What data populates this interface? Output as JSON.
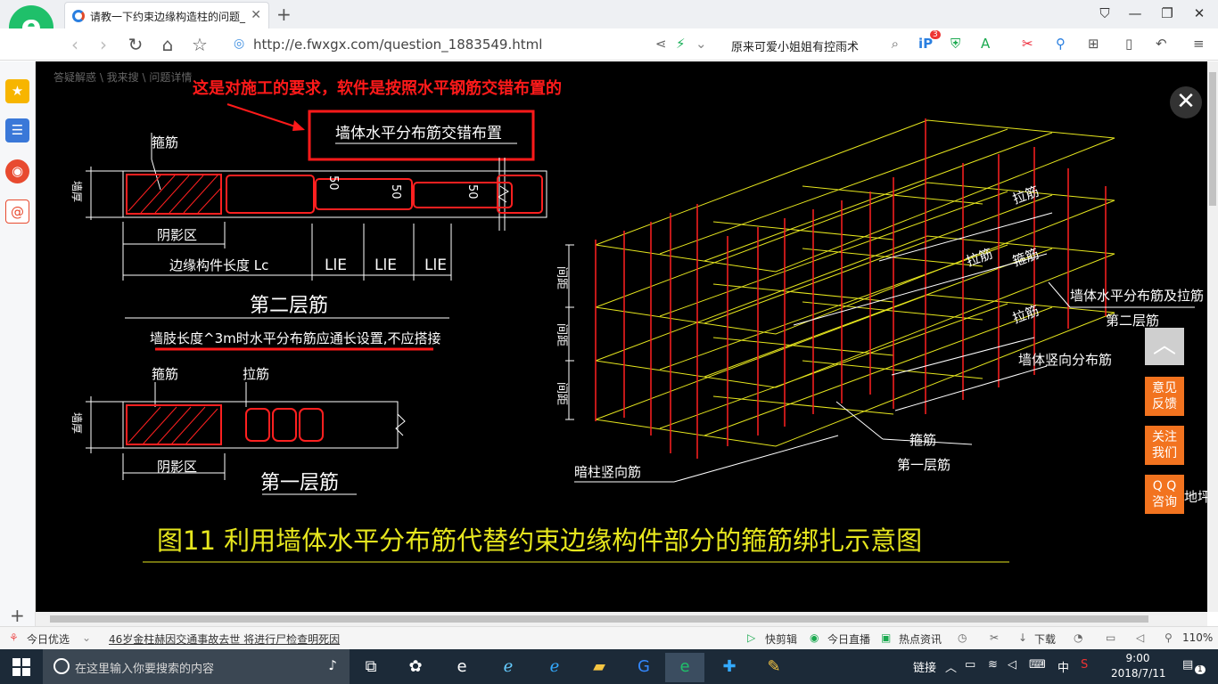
{
  "browser": {
    "tab_title": "请教一下约束边缘构造柱的问题_",
    "tab_close": "✕",
    "new_tab": "+",
    "url": "http://e.fwxgx.com/question_1883549.html",
    "search_query": "原来可爱小姐姐有控雨术",
    "badge_count": "3"
  },
  "breadcrumb": "答疑解惑 \\ 我来搜 \\ 问题详情",
  "drawing": {
    "annotation": "这是对施工的要求，软件是按照水平钢筋交错布置的",
    "boxed_label": "墙体水平分布筋交错布置",
    "top_section": {
      "stirrup_label": "箍筋",
      "left_dim": "墙厚",
      "shade_label": "阴影区",
      "length_label": "边缘构件长度 Lc",
      "lle": [
        "LlE",
        "LlE",
        "LlE"
      ],
      "offset_a": "50",
      "offset_b": "50",
      "offset_c": "50",
      "layer_title": "第二层筋",
      "note": "墙肢长度^3m时水平分布筋应通长设置,不应搭接"
    },
    "bottom_section": {
      "stirrup_label": "箍筋",
      "tie_label": "拉筋",
      "left_dim": "墙厚",
      "shade_label": "阴影区",
      "layer_title": "第一层筋"
    },
    "iso": {
      "spacing_labels": [
        "间距",
        "间距",
        "间距"
      ],
      "tie_1": "拉筋",
      "tie_2": "拉筋",
      "tie_3": "拉筋",
      "stirrup_top": "箍筋",
      "wall_horiz_tie": "墙体水平分布筋及拉筋",
      "layer_two": "第二层筋",
      "wall_vertical": "墙体竖向分布筋",
      "column_vertical": "暗柱竖向筋",
      "stirrup_bottom": "箍筋",
      "layer_one": "第一层筋",
      "cut_text": "地坪"
    },
    "caption": "图11  利用墙体水平分布筋代替约束边缘构件部分的箍筋绑扎示意图"
  },
  "float_buttons": {
    "top": "︿",
    "feedback": [
      "意见",
      "反馈"
    ],
    "follow": [
      "关注",
      "我们"
    ],
    "qq": [
      "Q Q",
      "咨询"
    ],
    "close": "✕"
  },
  "statusbar": {
    "today": "今日优选",
    "headline": "46岁金柱赫因交通事故去世 将进行尸检查明死因",
    "clip": "快剪辑",
    "live": "今日直播",
    "news": "热点资讯",
    "download": "下载",
    "zoom": "110%"
  },
  "taskbar": {
    "search_placeholder": "在这里输入你要搜索的内容",
    "link_label": "链接",
    "ime": "中",
    "time": "9:00",
    "date": "2018/7/11",
    "notif_count": "1"
  },
  "colors": {
    "cad_bg": "#000000",
    "cad_white": "#ffffff",
    "cad_red": "#ff2020",
    "cad_yellow": "#e6e61e",
    "annotation_red": "#ff1a1a",
    "float_orange": "#f2731f",
    "logo_green": "#1fc06a"
  }
}
